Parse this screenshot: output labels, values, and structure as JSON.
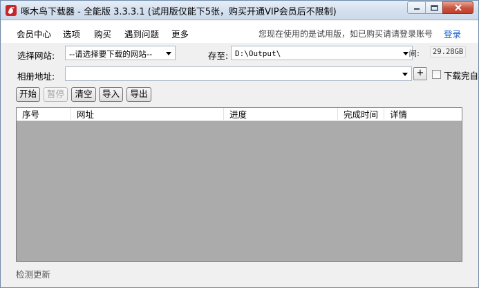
{
  "window": {
    "title": "啄木鸟下载器 - 全能版 3.3.3.1 (试用版仅能下5张，购买开通VIP会员后不限制)",
    "app_icon": "woodpecker-logo-icon",
    "controls": {
      "minimize_icon": "minimize-icon",
      "maximize_icon": "maximize-icon",
      "close_icon": "close-icon"
    }
  },
  "menu": {
    "items": [
      "会员中心",
      "选项",
      "购买",
      "遇到问题",
      "更多"
    ],
    "trial_note": "您现在使用的是试用版，如已购买请请登录账号",
    "login_label": "登录"
  },
  "form": {
    "site_label": "选择网站:",
    "site_value": "--请选择要下载的网站--",
    "save_label": "存至:",
    "save_value": "D:\\Output\\",
    "space_label": "空间:",
    "space_value": "29.28GB",
    "album_label": "相册地址:",
    "album_value": "",
    "add_button": "+",
    "done_checkbox_label": "下载完自",
    "done_checkbox_checked": false
  },
  "toolbar": {
    "start": "开始",
    "pause": "暂停",
    "clear": "清空",
    "import": "导入",
    "export": "导出"
  },
  "table": {
    "columns": [
      "序号",
      "网址",
      "进度",
      "完成时间",
      "详情"
    ],
    "rows": []
  },
  "status": {
    "check_update": "检测更新"
  },
  "colors": {
    "link": "#1a5fd1",
    "grid_background": "#ababab",
    "titlebar": "#d3dfee",
    "close_button": "#c9523d"
  }
}
